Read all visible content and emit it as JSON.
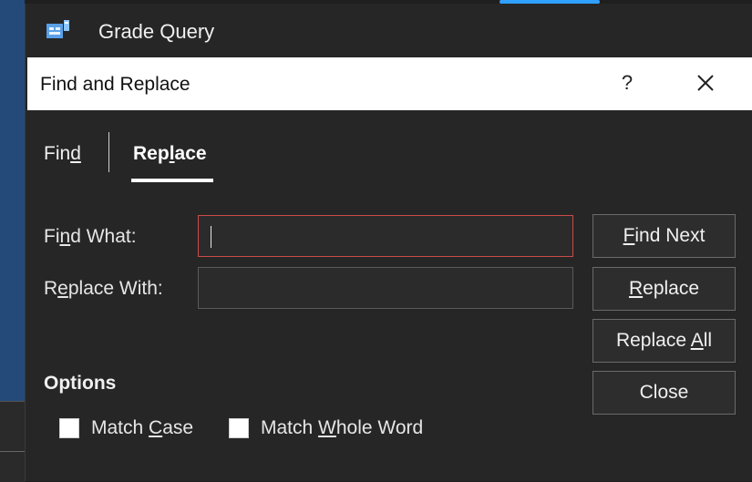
{
  "app": {
    "title": "Grade Query",
    "icon": "form-icon"
  },
  "dialog": {
    "title": "Find and Replace",
    "help_label": "?",
    "close_icon": "close-icon"
  },
  "tabs": [
    {
      "pre": "Fin",
      "key": "d",
      "post": "",
      "active": false
    },
    {
      "pre": "Rep",
      "key": "l",
      "post": "ace",
      "active": true
    }
  ],
  "fields": {
    "find": {
      "pre": "Fi",
      "key": "n",
      "post": "d What:",
      "value": ""
    },
    "replace": {
      "pre": "R",
      "key": "e",
      "post": "place With:",
      "value": ""
    }
  },
  "buttons": {
    "find_next": {
      "pre": "",
      "key": "F",
      "post": "ind Next"
    },
    "replace": {
      "pre": "",
      "key": "R",
      "post": "eplace"
    },
    "replace_all": {
      "pre": "Replace ",
      "key": "A",
      "post": "ll"
    },
    "close": {
      "label": "Close"
    }
  },
  "options": {
    "heading": "Options",
    "match_case": {
      "pre": "Match ",
      "key": "C",
      "post": "ase",
      "checked": false
    },
    "match_whole_word": {
      "pre": "Match ",
      "key": "W",
      "post": "hole Word",
      "checked": false
    }
  },
  "colors": {
    "dialog_background": "#262626",
    "header_background": "#ffffff",
    "find_input_border": "#c94a4a",
    "accent": "#2fa0ff"
  }
}
